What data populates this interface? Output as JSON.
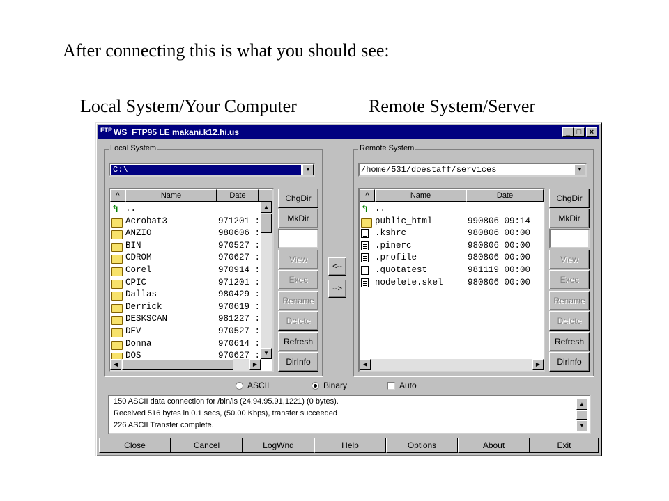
{
  "heading": "After connecting this is what you should see:",
  "label_local": "Local System/Your Computer",
  "label_remote": "Remote System/Server",
  "window": {
    "title": "WS_FTP95 LE makani.k12.hi.us",
    "icon_text": "FTP",
    "controls": {
      "minimize": "_",
      "maximize": "□",
      "close": "×"
    }
  },
  "local": {
    "group_label": "Local System",
    "path": "C:\\",
    "columns": {
      "sort": "^",
      "name": "Name",
      "date": "Date"
    },
    "rows": [
      {
        "icon": "up",
        "name": "..",
        "date": ""
      },
      {
        "icon": "folder",
        "name": "Acrobat3",
        "date": "971201 :"
      },
      {
        "icon": "folder",
        "name": "ANZIO",
        "date": "980606 :"
      },
      {
        "icon": "folder",
        "name": "BIN",
        "date": "970527 :"
      },
      {
        "icon": "folder",
        "name": "CDROM",
        "date": "970627 :"
      },
      {
        "icon": "folder",
        "name": "Corel",
        "date": "970914 :"
      },
      {
        "icon": "folder",
        "name": "CPIC",
        "date": "971201 :"
      },
      {
        "icon": "folder",
        "name": "Dallas",
        "date": "980429 :"
      },
      {
        "icon": "folder",
        "name": "Derrick",
        "date": "970619 :"
      },
      {
        "icon": "folder",
        "name": "DESKSCAN",
        "date": "981227 :"
      },
      {
        "icon": "folder",
        "name": "DEV",
        "date": "970527 :"
      },
      {
        "icon": "folder",
        "name": "Donna",
        "date": "970614 :"
      },
      {
        "icon": "folder",
        "name": "DOS",
        "date": "970627 :"
      }
    ],
    "buttons": {
      "chgdir": "ChgDir",
      "mkdir": "MkDir",
      "view": "View",
      "exec": "Exec",
      "rename": "Rename",
      "delete": "Delete",
      "refresh": "Refresh",
      "dirinfo": "DirInfo"
    }
  },
  "remote": {
    "group_label": "Remote System",
    "path": "/home/531/doestaff/services",
    "columns": {
      "sort": "^",
      "name": "Name",
      "date": "Date"
    },
    "rows": [
      {
        "icon": "up",
        "name": "..",
        "date": ""
      },
      {
        "icon": "folder",
        "name": "public_html",
        "date": "990806 09:14"
      },
      {
        "icon": "file",
        "name": ".kshrc",
        "date": "980806 00:00"
      },
      {
        "icon": "file",
        "name": ".pinerc",
        "date": "980806 00:00"
      },
      {
        "icon": "file",
        "name": ".profile",
        "date": "980806 00:00"
      },
      {
        "icon": "file",
        "name": ".quotatest",
        "date": "981119 00:00"
      },
      {
        "icon": "file",
        "name": "nodelete.skel",
        "date": "980806 00:00"
      }
    ],
    "buttons": {
      "chgdir": "ChgDir",
      "mkdir": "MkDir",
      "view": "View",
      "exec": "Exec",
      "rename": "Rename",
      "delete": "Delete",
      "refresh": "Refresh",
      "dirinfo": "DirInfo"
    }
  },
  "transfer": {
    "to_local": "<--",
    "to_remote": "-->"
  },
  "mode": {
    "ascii": "ASCII",
    "binary": "Binary",
    "auto": "Auto",
    "selected": "Binary",
    "auto_checked": false
  },
  "log": [
    "150 ASCII data connection for /bin/ls (24.94.95.91,1221) (0 bytes).",
    "Received 516 bytes in 0.1 secs, (50.00 Kbps), transfer succeeded",
    "226 ASCII Transfer complete."
  ],
  "bottom_buttons": [
    "Close",
    "Cancel",
    "LogWnd",
    "Help",
    "Options",
    "About",
    "Exit"
  ],
  "scroll_glyphs": {
    "up": "▲",
    "down": "▼",
    "left": "◀",
    "right": "▶"
  }
}
